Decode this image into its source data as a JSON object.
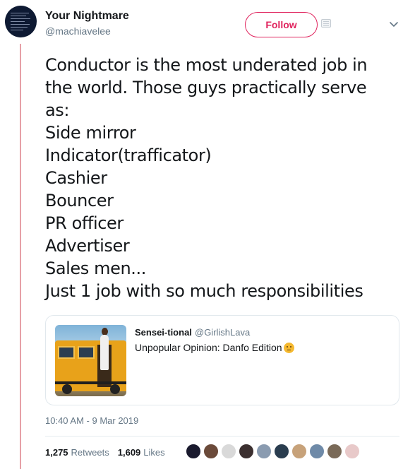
{
  "author": {
    "name": "Your Nightmare",
    "handle": "@machiavelee",
    "avatar_icon": "avatar-text-image"
  },
  "header": {
    "follow_label": "Follow",
    "accent_color": "#e0245e"
  },
  "tweet": {
    "lines": [
      "Conductor is the most underated job in",
      "the world. Those guys practically serve",
      "as:",
      "Side mirror",
      "Indicator(trafficator)",
      "Cashier",
      "Bouncer",
      "PR officer",
      "Advertiser",
      "Sales men...",
      "Just 1 job with so much responsibilities"
    ]
  },
  "quote": {
    "name": "Sensei-tional",
    "handle": "@GirlishLava",
    "text": "Unpopular Opinion: Danfo Edition",
    "emoji_icon": "thinking-face-icon",
    "image_icon": "danfo-bus-photo"
  },
  "timestamp": "10:40 AM - 9 Mar 2019",
  "stats": {
    "retweets_count": "1,275",
    "retweets_label": "Retweets",
    "likes_count": "1,609",
    "likes_label": "Likes"
  },
  "likers": {
    "colors": [
      "#1a1a2e",
      "#6b4a3a",
      "#d9d9d9",
      "#3b2f2f",
      "#8a9bb0",
      "#2a3d4f",
      "#c7a27a",
      "#6f8aa8",
      "#7a6a58",
      "#e8c9c9"
    ]
  }
}
